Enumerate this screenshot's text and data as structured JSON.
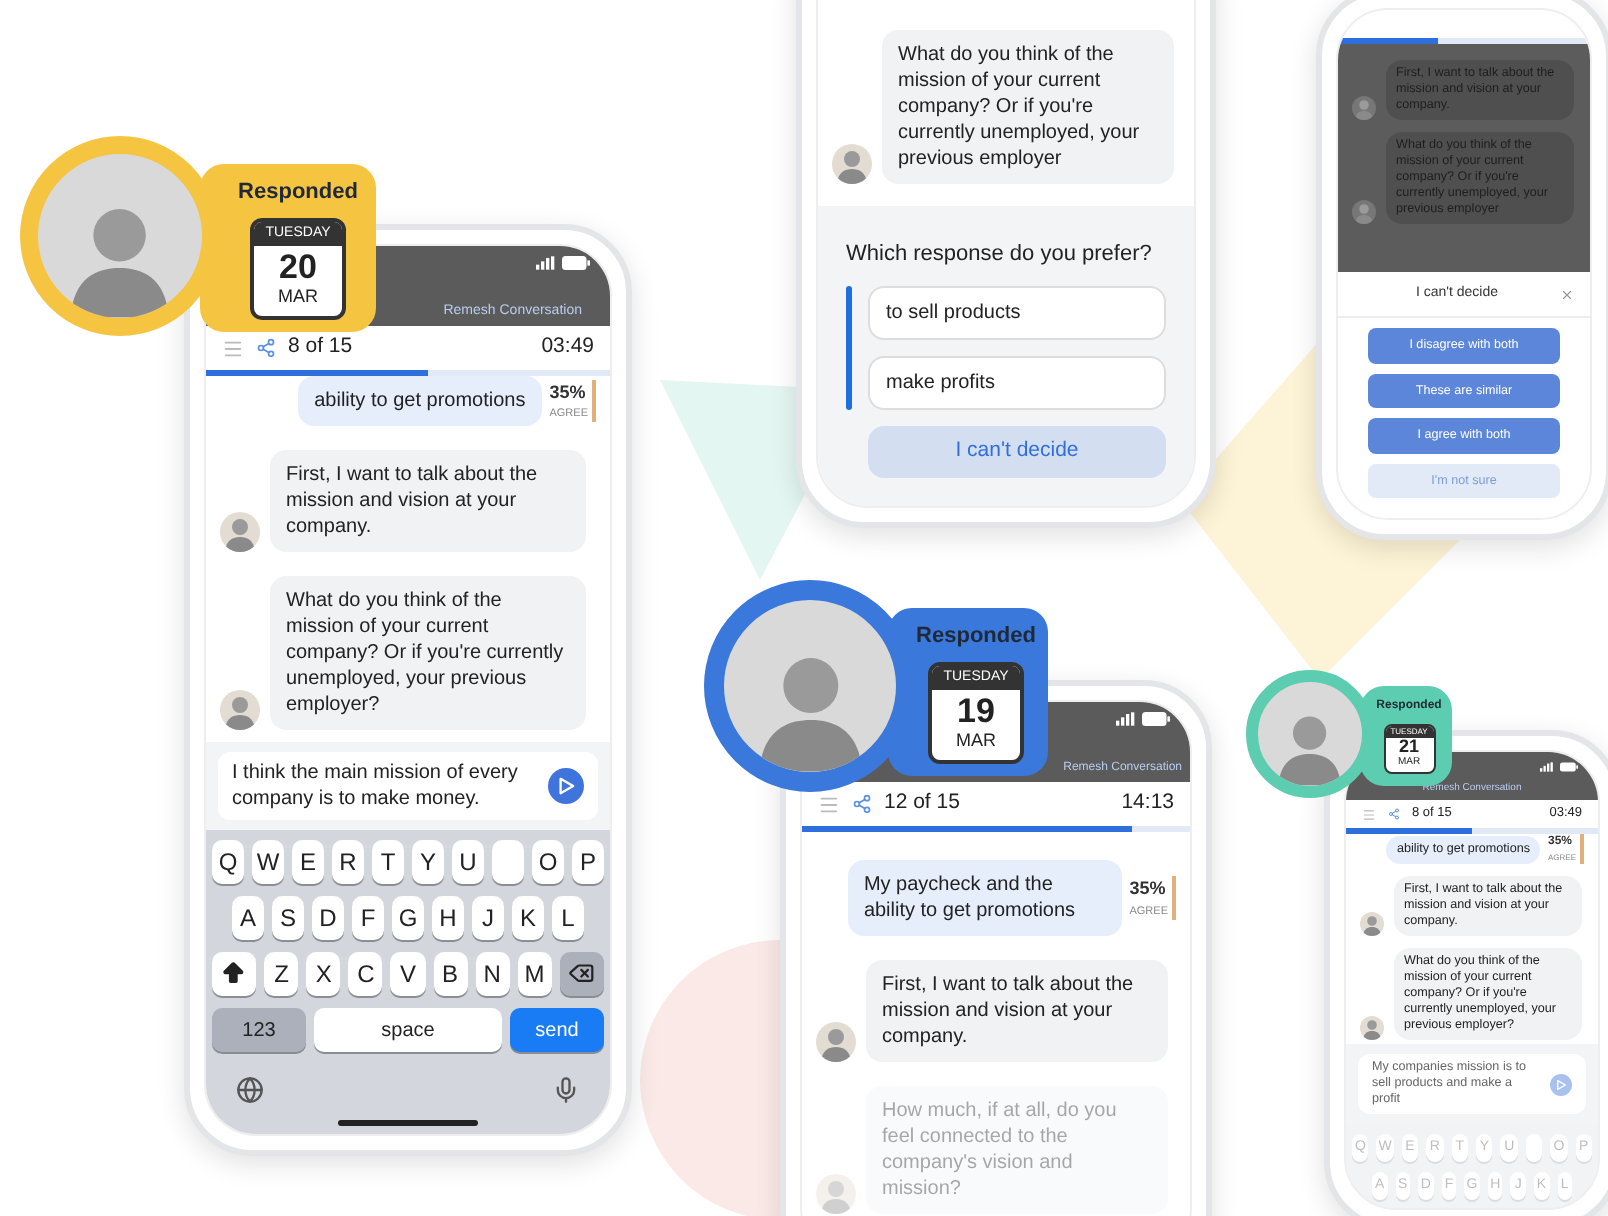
{
  "phones": [
    {
      "badge": {
        "label": "Responded",
        "weekday": "TUESDAY",
        "day": "20",
        "month": "MAR",
        "color": "#f5c542"
      },
      "header": "Remesh Conversation",
      "toolbar": {
        "count": "8 of 15",
        "time": "03:49",
        "level": 0.55
      },
      "messages": [
        {
          "kind": "user",
          "text": "ability to get promotions",
          "percent": "35%",
          "percent_label": "AGREE"
        },
        {
          "kind": "bot",
          "text": "First, I want to talk about the mission and vision at your company.",
          "faded": false
        },
        {
          "kind": "bot",
          "text": "What do you think of the mission of your current company? Or if you're currently unemployed, your previous employer?",
          "faded": false
        }
      ],
      "input": {
        "value": "I think the main mission of every company is to make money."
      },
      "keyboard": {
        "faded": false,
        "rows": [
          {
            "keys": [
              {
                "kind": "letter",
                "label": "Q"
              },
              {
                "kind": "letter",
                "label": "W"
              },
              {
                "kind": "letter",
                "label": "E"
              },
              {
                "kind": "letter",
                "label": "R"
              },
              {
                "kind": "letter",
                "label": "T"
              },
              {
                "kind": "letter",
                "label": "Y"
              },
              {
                "kind": "letter",
                "label": "U"
              },
              {
                "kind": "blank"
              },
              {
                "kind": "letter",
                "label": "O"
              },
              {
                "kind": "letter",
                "label": "P"
              }
            ]
          },
          {
            "keys": [
              {
                "kind": "letter",
                "label": "A"
              },
              {
                "kind": "letter",
                "label": "S"
              },
              {
                "kind": "letter",
                "label": "D"
              },
              {
                "kind": "letter",
                "label": "F"
              },
              {
                "kind": "letter",
                "label": "G"
              },
              {
                "kind": "letter",
                "label": "H"
              },
              {
                "kind": "letter",
                "label": "J"
              },
              {
                "kind": "letter",
                "label": "K"
              },
              {
                "kind": "letter",
                "label": "L"
              }
            ]
          },
          {
            "keys": [
              {
                "kind": "shift"
              },
              {
                "kind": "letter",
                "label": "Z"
              },
              {
                "kind": "letter",
                "label": "X"
              },
              {
                "kind": "letter",
                "label": "C"
              },
              {
                "kind": "letter",
                "label": "V"
              },
              {
                "kind": "letter",
                "label": "B"
              },
              {
                "kind": "letter",
                "label": "N"
              },
              {
                "kind": "letter",
                "label": "M"
              },
              {
                "kind": "backspace"
              }
            ]
          },
          {
            "keys": [
              {
                "kind": "mode",
                "label": "123"
              },
              {
                "kind": "space",
                "label": "space"
              },
              {
                "kind": "send",
                "label": "send"
              }
            ]
          }
        ]
      }
    },
    {
      "messages": [
        {
          "kind": "bot",
          "text": "What do you think of the mission of your current company? Or if you're currently unemployed, your previous employer",
          "faded": false
        }
      ],
      "prompt": {
        "question": "Which response do you prefer?",
        "options": [
          "to sell products",
          "make profits"
        ],
        "button": "I can't decide"
      }
    },
    {
      "toolbar": {
        "level": 0.4
      },
      "messages": [
        {
          "kind": "bot",
          "text": "First, I want to talk about the mission and vision at your company.",
          "faded": false
        },
        {
          "kind": "bot",
          "text": "What do you think of the mission of your current company? Or if you're currently unemployed, your previous employer",
          "faded": false
        }
      ],
      "sheet": {
        "title": "I can't decide",
        "buttons": [
          {
            "label": "I disagree with both",
            "kind": "primary"
          },
          {
            "label": "These are similar",
            "kind": "primary"
          },
          {
            "label": "I agree with both",
            "kind": "primary"
          },
          {
            "label": "I'm not sure",
            "kind": "secondary"
          }
        ]
      }
    },
    {
      "badge": {
        "label": "Responded",
        "weekday": "TUESDAY",
        "day": "19",
        "month": "MAR",
        "color": "#3a78dc"
      },
      "header": "Remesh Conversation",
      "toolbar": {
        "count": "12 of 15",
        "time": "14:13",
        "level": 0.85
      },
      "messages": [
        {
          "kind": "user",
          "text": "My paycheck and the ability to get promotions",
          "percent": "35%",
          "percent_label": "AGREE"
        },
        {
          "kind": "bot",
          "text": "First, I want to talk about the mission and vision at your company.",
          "faded": false
        },
        {
          "kind": "bot",
          "text": "How much, if at all, do you feel connected to the company's vision and mission?",
          "faded": true
        }
      ]
    },
    {
      "badge": {
        "label": "Responded",
        "weekday": "TUESDAY",
        "day": "21",
        "month": "MAR",
        "color": "#5ccdb0"
      },
      "header": "Remesh Conversation",
      "toolbar": {
        "count": "8 of 15",
        "time": "03:49",
        "level": 0.5
      },
      "messages": [
        {
          "kind": "user",
          "text": "ability to get promotions",
          "percent": "35%",
          "percent_label": "AGREE"
        },
        {
          "kind": "bot",
          "text": "First, I want to talk about the mission and vision at your company.",
          "faded": false
        },
        {
          "kind": "bot",
          "text": "What do you think of the mission of your current company? Or if you're currently unemployed, your previous employer?",
          "faded": false
        }
      ],
      "input": {
        "value": "My companies mission is to sell products and make a profit"
      },
      "keyboard": {
        "faded": true,
        "rows": [
          {
            "keys": [
              {
                "kind": "letter",
                "label": "Q"
              },
              {
                "kind": "letter",
                "label": "W"
              },
              {
                "kind": "letter",
                "label": "E"
              },
              {
                "kind": "letter",
                "label": "R"
              },
              {
                "kind": "letter",
                "label": "T"
              },
              {
                "kind": "letter",
                "label": "Y"
              },
              {
                "kind": "letter",
                "label": "U"
              },
              {
                "kind": "blank"
              },
              {
                "kind": "letter",
                "label": "O"
              },
              {
                "kind": "letter",
                "label": "P"
              }
            ]
          },
          {
            "keys": [
              {
                "kind": "letter",
                "label": "A"
              },
              {
                "kind": "letter",
                "label": "S"
              },
              {
                "kind": "letter",
                "label": "D"
              },
              {
                "kind": "letter",
                "label": "F"
              },
              {
                "kind": "letter",
                "label": "G"
              },
              {
                "kind": "letter",
                "label": "H"
              },
              {
                "kind": "letter",
                "label": "J"
              },
              {
                "kind": "letter",
                "label": "K"
              },
              {
                "kind": "letter",
                "label": "L"
              }
            ]
          }
        ]
      }
    }
  ]
}
